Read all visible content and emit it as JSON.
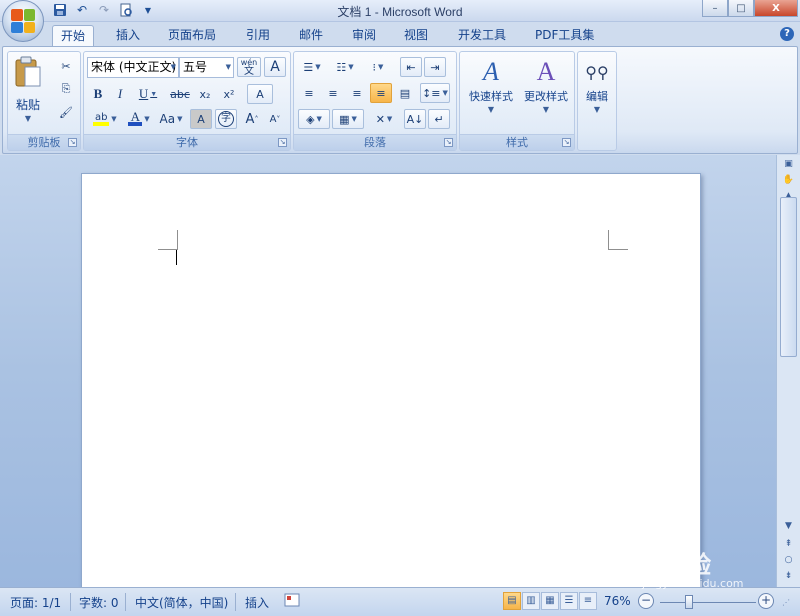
{
  "window": {
    "title": "文档 1 - Microsoft Word",
    "minimize": "–",
    "maximize": "□",
    "close": "X"
  },
  "tabs": [
    "开始",
    "插入",
    "页面布局",
    "引用",
    "邮件",
    "审阅",
    "视图",
    "开发工具",
    "PDF工具集"
  ],
  "active_tab": "开始",
  "help": "?",
  "ribbon": {
    "clipboard": {
      "label": "剪贴板",
      "paste": "粘贴"
    },
    "font": {
      "label": "字体",
      "font_name": "宋体 (中文正文)",
      "font_size": "五号",
      "bold": "B",
      "italic": "I",
      "underline": "U",
      "strikethrough": "abc",
      "subscript": "x₂",
      "superscript": "x²",
      "change_case": "Aa",
      "grow": "A",
      "shrink": "A",
      "char_shade": "A",
      "enclose": "字",
      "phonetic": "wén",
      "phonetic_char": "文",
      "char_border": "A",
      "clear_format": "A",
      "highlight": "ab",
      "font_color": "A"
    },
    "paragraph": {
      "label": "段落"
    },
    "styles": {
      "label": "样式",
      "quick_styles": "快速样式",
      "change_styles": "更改样式"
    },
    "editing": {
      "label": "编辑",
      "edit": "编辑"
    }
  },
  "status": {
    "page": "页面: 1/1",
    "words": "字数: 0",
    "language": "中文(简体，中国)",
    "mode": "插入",
    "zoom": "76%",
    "zoom_level": 0.3
  },
  "watermark": {
    "brand": "Bai 经验",
    "url": "jingyan.baidu.com"
  },
  "colors": {
    "highlight_yellow": "#ffff00",
    "font_color_blue": "#1f4fbf",
    "active_button": "#f7b54a",
    "ribbon_blue": "#15428b"
  }
}
